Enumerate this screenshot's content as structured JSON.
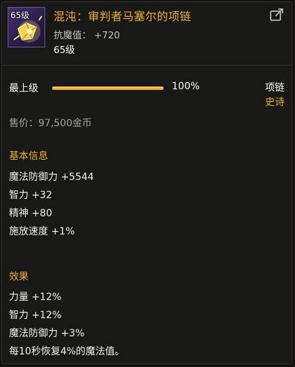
{
  "item": {
    "icon_level": "65级",
    "name": "混沌：审判者马塞尔的项链",
    "resistance_line": "抗魔值： +720",
    "required_level": "65级",
    "grade_label": "最上级",
    "grade_percent_text": "100%",
    "grade_fraction": 1.0,
    "type": "项链",
    "rarity": "史诗",
    "price_line": "售价：97,500金币"
  },
  "basic_info": {
    "title": "基本信息",
    "stats": [
      "魔法防御力 +5544",
      "智力 +32",
      "精神 +80",
      "施放速度 +1%"
    ]
  },
  "effects": {
    "title": "效果",
    "stats": [
      "力量 +12%",
      "智力 +12%",
      "魔法防御力 +3%",
      "每10秒恢复4%的魔法值。"
    ]
  },
  "colors": {
    "epic_orange": "#f0b032",
    "text_white": "#f2f0ec",
    "text_gray": "#a7a49e",
    "background": "#181816"
  },
  "icons": {
    "item": "necklace-icon",
    "share": "share-icon"
  }
}
